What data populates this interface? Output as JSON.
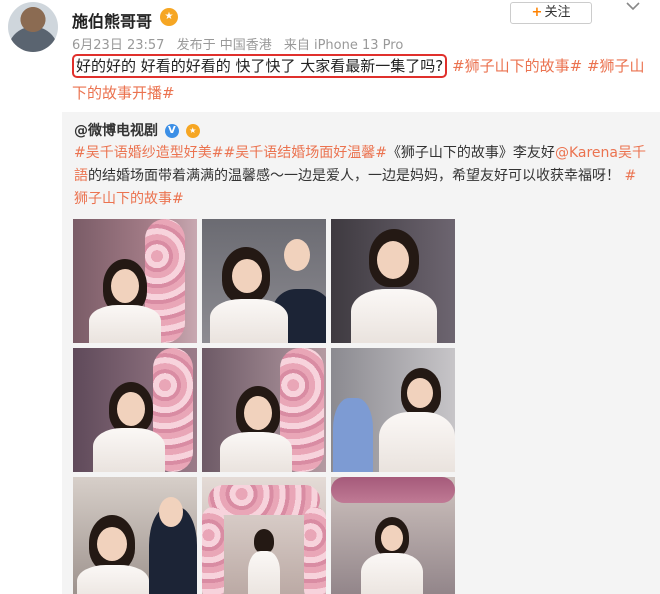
{
  "post": {
    "username": "施伯熊哥哥",
    "follow_label": "关注",
    "date": "6月23日 23:57",
    "posted_from": "发布于 中国香港",
    "device": "来自 iPhone 13 Pro",
    "text_highlight": "好的好的 好看的好看的 快了快了 大家看最新一集了吗?",
    "tag1": "#狮子山下的故事#",
    "tag2": "#狮子山下的故事开播#"
  },
  "repost": {
    "author": "@微博电视剧",
    "tag_a": "#吴千语婚纱造型好美#",
    "tag_b": "#吴千语结婚场面好温馨#",
    "text_1": "《狮子山下的故事》李友好",
    "mention": "@Karena吴千語",
    "text_2": "的结婚场面带着满满的温馨感～一边是爱人，一边是妈妈，希望友好可以收获幸福呀！",
    "tag_c": "#狮子山下的故事#"
  },
  "icons": {
    "avatar": "avatar",
    "vip_badge": "vip-badge-icon",
    "verified": "verified-v-icon",
    "chevron": "chevron-down-icon"
  },
  "colors": {
    "hashtag": "#eb7350",
    "highlight_border": "#e0302c",
    "follow_plus": "#ff8200",
    "repost_bg": "#f4f4f4"
  }
}
